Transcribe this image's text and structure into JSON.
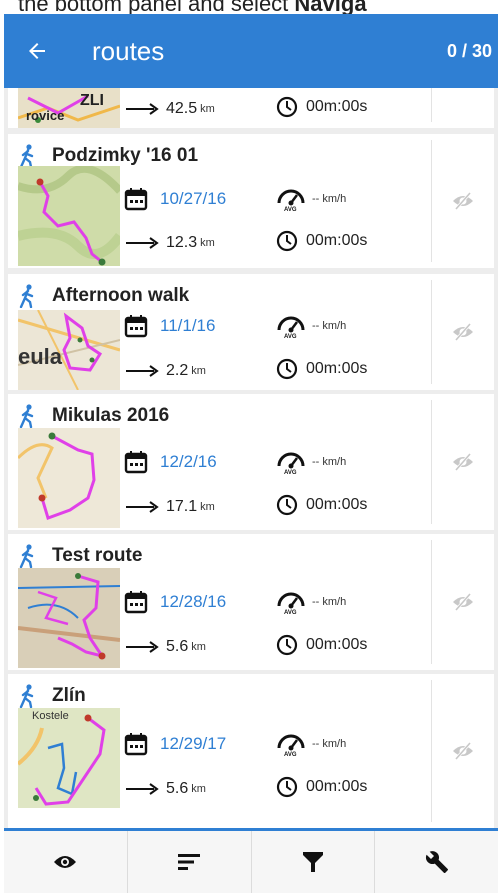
{
  "header": {
    "title": "routes",
    "count": "0 / 30",
    "back_icon": "arrow-left-icon"
  },
  "top_caption": {
    "prefix": "the bottom panel and select ",
    "bold": "Naviga"
  },
  "partial_row": {
    "place_label": "ZLI",
    "place_label_2": "rovice",
    "distance": "42.5",
    "distance_unit": "km",
    "time": "00m:00s"
  },
  "routes": [
    {
      "name": "Podzimky '16 01",
      "date": "10/27/16",
      "speed": "-- km/h",
      "distance": "12.3",
      "distance_unit": "km",
      "time": "00m:00s"
    },
    {
      "name": "Afternoon walk",
      "date": "11/1/16",
      "speed": "-- km/h",
      "distance": "2.2",
      "distance_unit": "km",
      "time": "00m:00s",
      "thumb_label": "eula"
    },
    {
      "name": "Mikulas 2016",
      "date": "12/2/16",
      "speed": "-- km/h",
      "distance": "17.1",
      "distance_unit": "km",
      "time": "00m:00s"
    },
    {
      "name": "Test route",
      "date": "12/28/16",
      "speed": "-- km/h",
      "distance": "5.6",
      "distance_unit": "km",
      "time": "00m:00s"
    },
    {
      "name": "Zlín",
      "date": "12/29/17",
      "speed": "-- km/h",
      "distance": "5.6",
      "distance_unit": "km",
      "time": "00m:00s",
      "thumb_label": "Kostele"
    }
  ],
  "bottom_nav": [
    {
      "icon": "eye-icon"
    },
    {
      "icon": "sort-icon"
    },
    {
      "icon": "filter-icon"
    },
    {
      "icon": "wrench-icon"
    }
  ],
  "colors": {
    "appbar": "#2f7fd3",
    "date_text": "#2f7fd3",
    "route_line": "#e040e8",
    "list_bg": "#ededed"
  }
}
